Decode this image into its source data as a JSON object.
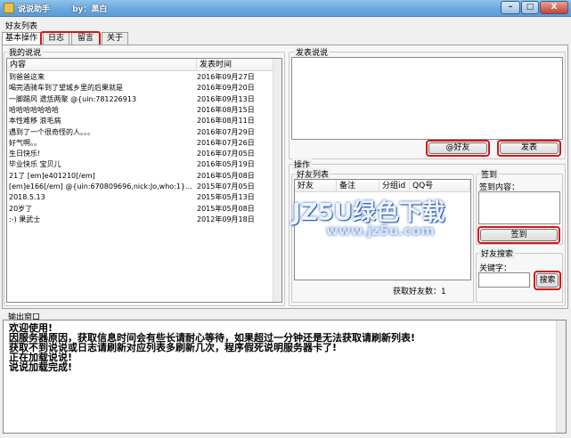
{
  "window": {
    "title": "说说助手        by：黑白",
    "minimize": "–",
    "maximize": "□",
    "close": "X"
  },
  "menu": {
    "item": "好友列表"
  },
  "tabs": [
    "基本操作",
    "日志",
    "留言",
    "关于"
  ],
  "my_posts": {
    "group_title": "我的说说",
    "columns": [
      "内容",
      "发表时间"
    ],
    "rows": [
      [
        "到爸爸这来",
        "2016年09月27日"
      ],
      [
        "喝完酒骑车到了望城乡里的后果就是",
        "2016年09月20日"
      ],
      [
        "一脚踢风 遗恁两聚 @{uin:781226913",
        "2016年09月13日"
      ],
      [
        "哈哈哈哈哈哈哈",
        "2016年08月15日"
      ],
      [
        "本性难移 浪毛病",
        "2016年08月11日"
      ],
      [
        "遇到了一个很奇怪的人。。。",
        "2016年07月29日"
      ],
      [
        "好气啊。。",
        "2016年07月26日"
      ],
      [
        "生日快乐!",
        "2016年07月05日"
      ],
      [
        "毕业快乐 宝贝儿",
        "2016年05月19日"
      ],
      [
        "21了 [em]e401210[/em]",
        "2016年05月08日"
      ],
      [
        "[em]e166[/em] @{uin:670809696,nick:Jo,who:1}...",
        "2015年07月05日"
      ],
      [
        "2018.5.13",
        "2015年05月13日"
      ],
      [
        "20岁了",
        "2015年05月08日"
      ],
      [
        ":-) 果武士",
        "2012年09月18日"
      ]
    ]
  },
  "publish": {
    "group_title": "发表说说",
    "at_friend_button": "@好友",
    "publish_button": "发表"
  },
  "operations": {
    "group_title": "操作",
    "friend_list": {
      "group_title": "好友列表",
      "columns": [
        "好友",
        "备注",
        "分组id",
        "QQ号"
      ],
      "count_label": "获取好友数：1"
    },
    "sign_in": {
      "group_title": "签到",
      "content_label": "签到内容：",
      "button": "签到"
    },
    "friend_search": {
      "group_title": "好友搜索",
      "keyword_label": "关键字：",
      "button": "搜索"
    }
  },
  "output": {
    "group_title": "输出窗口",
    "lines": [
      "欢迎使用!",
      "因服务器原因，获取信息时间会有些长请耐心等待，如果超过一分钟还是无法获取请刷新列表!",
      "获取不到说说或日志请刷新对应列表多刷新几次，程序假死说明服务器卡了!",
      "正在加载说说!",
      "说说加载完成!"
    ]
  },
  "watermark": {
    "logo": "JZ5U绿色下载",
    "url": "www.jz5u.com"
  },
  "colors": {
    "highlight_red": "#d01818",
    "titlebar_blue": "#6aa9de",
    "window_bg": "#f0f0f0"
  }
}
